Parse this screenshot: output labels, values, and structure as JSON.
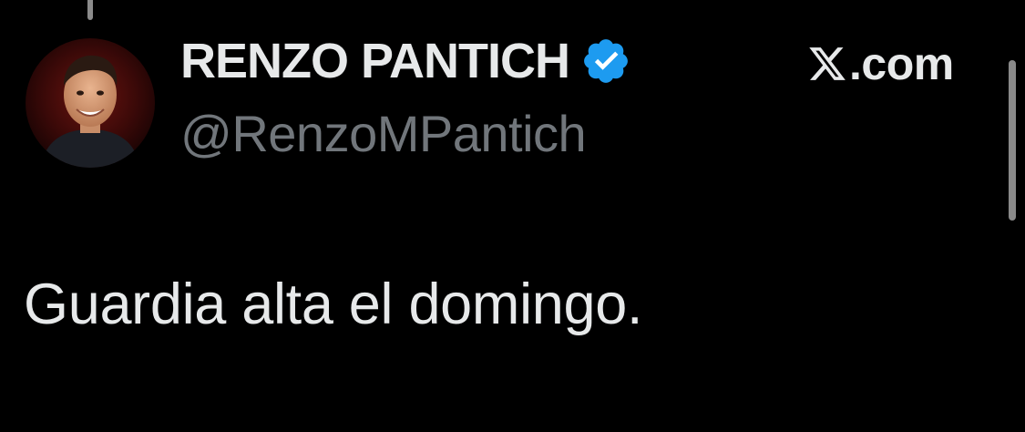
{
  "tweet": {
    "author": {
      "display_name": "RENZO PANTICH",
      "handle": "@RenzoMPantich",
      "verified": true,
      "avatar_icon": "user-avatar-photo"
    },
    "text": "Guardia alta el domingo."
  },
  "brand": {
    "icon": "x-logo-icon",
    "domain": ".com"
  },
  "colors": {
    "background": "#000000",
    "primary_text": "#e7e9ea",
    "secondary_text": "#71767b",
    "verified_blue": "#1d9bf0"
  }
}
